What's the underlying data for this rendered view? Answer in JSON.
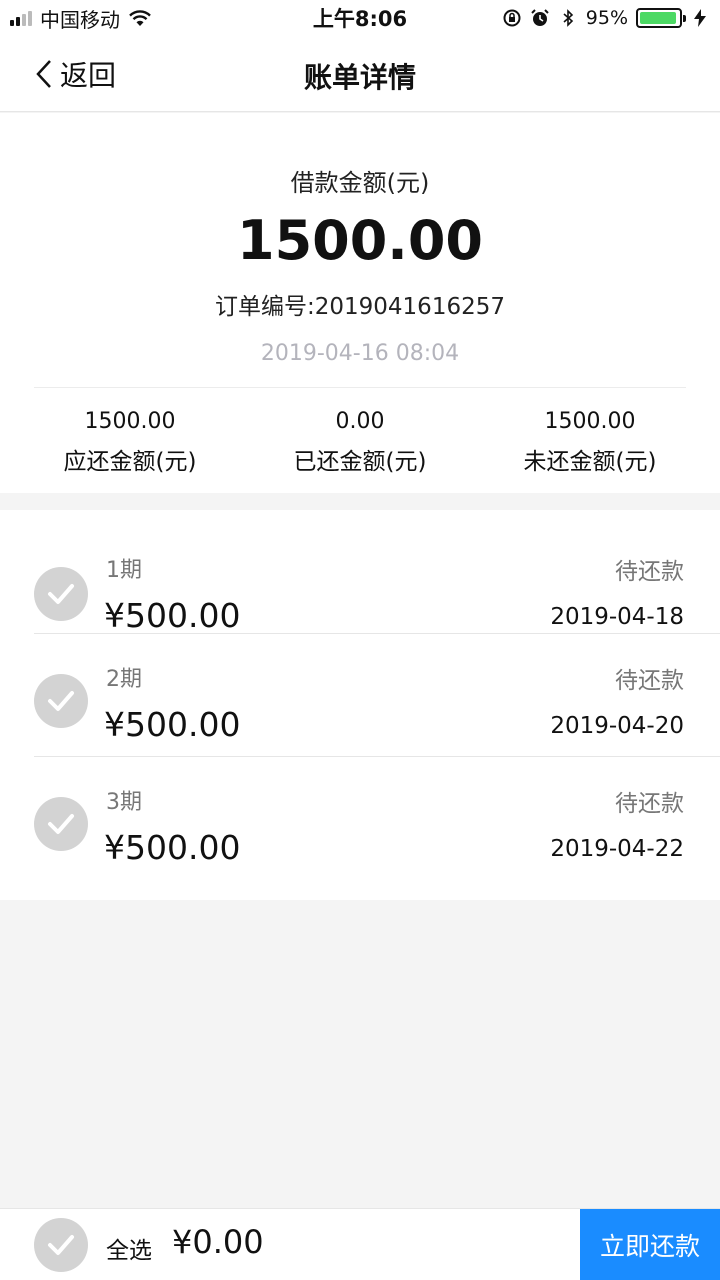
{
  "status_bar": {
    "carrier": "中国移动",
    "time": "上午8:06",
    "battery": "95%",
    "battery_level": 0.95
  },
  "nav": {
    "back_label": "返回",
    "title": "账单详情"
  },
  "summary": {
    "loan_label": "借款金额(元)",
    "loan_amount": "1500.00",
    "order_number": "订单编号:2019041616257",
    "order_time": "2019-04-16 08:04",
    "stats": [
      {
        "value": "1500.00",
        "label": "应还金额(元)"
      },
      {
        "value": "0.00",
        "label": "已还金额(元)"
      },
      {
        "value": "1500.00",
        "label": "未还金额(元)"
      }
    ]
  },
  "installments": [
    {
      "period": "1期",
      "amount": "¥500.00",
      "status": "待还款",
      "due_date": "2019-04-18"
    },
    {
      "period": "2期",
      "amount": "¥500.00",
      "status": "待还款",
      "due_date": "2019-04-20"
    },
    {
      "period": "3期",
      "amount": "¥500.00",
      "status": "待还款",
      "due_date": "2019-04-22"
    }
  ],
  "bottom_bar": {
    "select_all_label": "全选",
    "total": "¥0.00",
    "pay_button_label": "立即还款"
  },
  "colors": {
    "accent": "#1a8cff",
    "check_inactive": "#d3d3d3",
    "battery": "#4cd964"
  }
}
